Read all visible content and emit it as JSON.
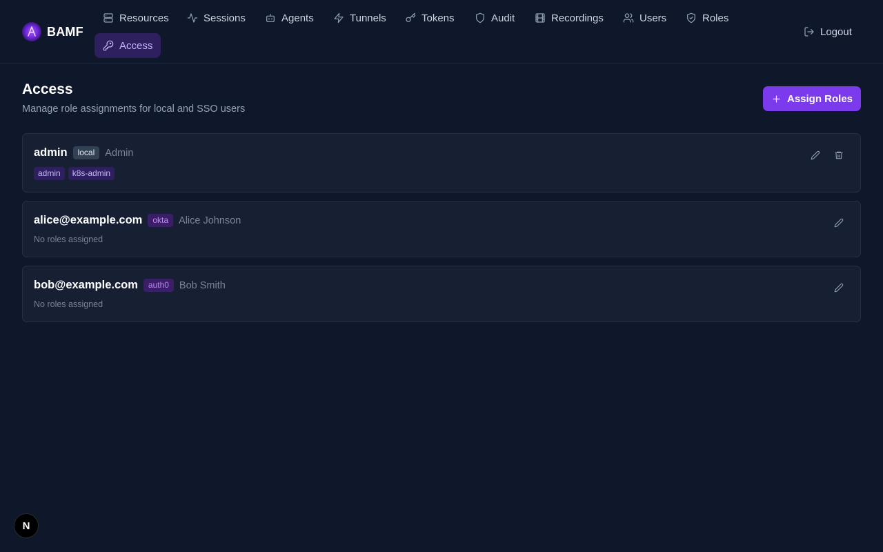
{
  "app": {
    "name": "BAMF"
  },
  "nav": {
    "items": [
      {
        "label": "Resources",
        "icon": "server-icon"
      },
      {
        "label": "Sessions",
        "icon": "activity-icon"
      },
      {
        "label": "Agents",
        "icon": "bot-icon"
      },
      {
        "label": "Tunnels",
        "icon": "zap-icon"
      },
      {
        "label": "Tokens",
        "icon": "key-icon"
      },
      {
        "label": "Audit",
        "icon": "shield-icon"
      },
      {
        "label": "Recordings",
        "icon": "film-icon"
      },
      {
        "label": "Users",
        "icon": "users-icon"
      },
      {
        "label": "Roles",
        "icon": "shield-check-icon"
      },
      {
        "label": "Access",
        "icon": "key-round-icon",
        "active": true
      }
    ],
    "logout_label": "Logout"
  },
  "page": {
    "title": "Access",
    "subtitle": "Manage role assignments for local and SSO users",
    "assign_button_label": "Assign Roles"
  },
  "users": [
    {
      "name": "admin",
      "provider": "local",
      "display_name": "Admin",
      "roles": [
        "admin",
        "k8s-admin"
      ],
      "no_roles_text": ""
    },
    {
      "name": "alice@example.com",
      "provider": "okta",
      "display_name": "Alice Johnson",
      "roles": [],
      "no_roles_text": "No roles assigned"
    },
    {
      "name": "bob@example.com",
      "provider": "auth0",
      "display_name": "Bob Smith",
      "roles": [],
      "no_roles_text": "No roles assigned"
    }
  ],
  "badge": {
    "label": "N"
  },
  "colors": {
    "background": "#0f172a",
    "card": "#172033",
    "accent": "#7c3aed",
    "active_nav_bg": "#2e1f5e",
    "role_chip_text": "#c4b5fd"
  }
}
